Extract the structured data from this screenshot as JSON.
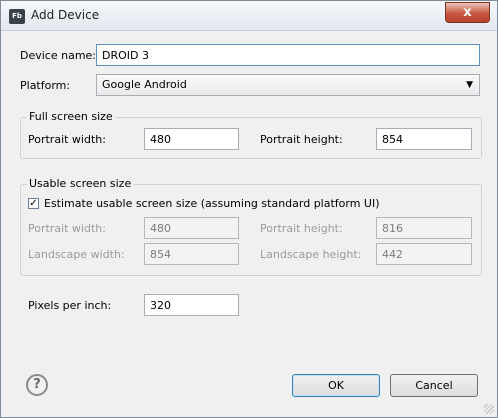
{
  "window": {
    "title": "Add Device",
    "app_icon_text": "Fb",
    "close_glyph": "x"
  },
  "form": {
    "device_name_label": "Device name:",
    "device_name_value": "DROID 3",
    "platform_label": "Platform:",
    "platform_value": "Google Android",
    "full_screen": {
      "title": "Full screen size",
      "portrait_width_label": "Portrait width:",
      "portrait_width_value": "480",
      "portrait_height_label": "Portrait height:",
      "portrait_height_value": "854"
    },
    "usable_screen": {
      "title": "Usable screen size",
      "estimate_label": "Estimate usable screen size (assuming standard platform UI)",
      "estimate_checked": true,
      "portrait_width_label": "Portrait width:",
      "portrait_width_value": "480",
      "portrait_height_label": "Portrait height:",
      "portrait_height_value": "816",
      "landscape_width_label": "Landscape width:",
      "landscape_width_value": "854",
      "landscape_height_label": "Landscape height:",
      "landscape_height_value": "442"
    },
    "ppi_label": "Pixels per inch:",
    "ppi_value": "320"
  },
  "buttons": {
    "ok": "OK",
    "cancel": "Cancel",
    "help_glyph": "?"
  }
}
